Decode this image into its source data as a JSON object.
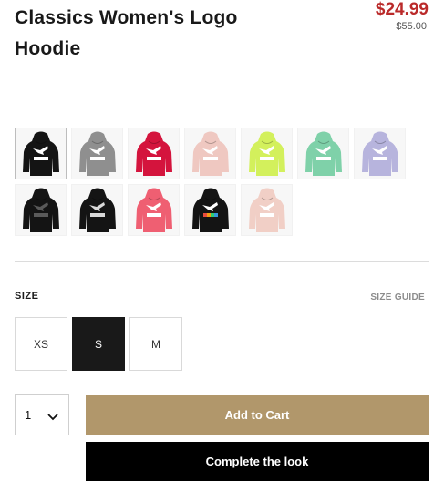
{
  "product": {
    "title": "Classics Women's Logo Hoodie",
    "sale_price": "$24.99",
    "original_price": "$55.00"
  },
  "swatches": {
    "row1": [
      {
        "name": "black-white",
        "body": "#141414",
        "logo": "#ffffff",
        "selected": true
      },
      {
        "name": "grey",
        "body": "#8f8f8f",
        "logo": "#ffffff"
      },
      {
        "name": "red",
        "body": "#d4143d",
        "logo": "#ffffff"
      },
      {
        "name": "pink",
        "body": "#efc8c1",
        "logo": "#ffffff"
      },
      {
        "name": "lime",
        "body": "#d3f05c",
        "logo": "#ffffff"
      },
      {
        "name": "mint",
        "body": "#7fd1a9",
        "logo": "#ffffff"
      },
      {
        "name": "lavender",
        "body": "#b7b4dd",
        "logo": "#ffffff"
      }
    ],
    "row2": [
      {
        "name": "black-dark-logo",
        "body": "#141414",
        "logo": "#5a5a5a"
      },
      {
        "name": "black-silver",
        "body": "#141414",
        "logo": "#d9d9d9"
      },
      {
        "name": "coral",
        "body": "#ef5f72",
        "logo": "#ffffff"
      },
      {
        "name": "black-rainbow",
        "body": "#141414",
        "logo": "#ffffff",
        "rainbow": true
      },
      {
        "name": "blush",
        "body": "#f1cfc6",
        "logo": "#ffffff"
      }
    ]
  },
  "size": {
    "label": "SIZE",
    "guide": "SIZE GUIDE",
    "options": [
      "XS",
      "S",
      "M"
    ],
    "selected": "S"
  },
  "cart": {
    "quantity": "1",
    "add_label": "Add to Cart",
    "complete_label": "Complete the look"
  },
  "colors": {
    "sale": "#ba2a2a",
    "add_to_cart": "#b1976b",
    "complete_look": "#000000"
  }
}
